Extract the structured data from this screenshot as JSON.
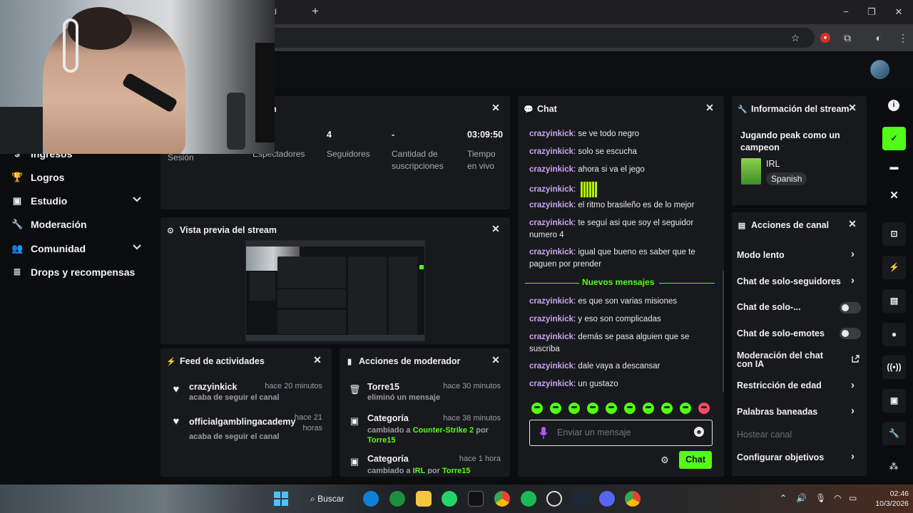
{
  "browser": {
    "tab_fragment": "ard",
    "new_tab": "+",
    "minimize": "−",
    "maximize": "❐",
    "close": "✕"
  },
  "sidebar": {
    "items": [
      {
        "label": "Ingresos",
        "icon": "dollar-icon"
      },
      {
        "label": "Logros",
        "icon": "trophy-icon"
      },
      {
        "label": "Estudio",
        "icon": "studio-icon"
      },
      {
        "label": "Moderación",
        "icon": "wrench-icon"
      },
      {
        "label": "Comunidad",
        "icon": "people-icon"
      },
      {
        "label": "Drops y recompensas",
        "icon": "drops-icon"
      }
    ]
  },
  "session": {
    "title_fragment": "n",
    "stats": [
      {
        "value": "",
        "label": "Sesión"
      },
      {
        "value": "",
        "label": "Espectadores"
      },
      {
        "value": "4",
        "label": "Seguidores"
      },
      {
        "value": "-",
        "label": "Cantidad de suscripciones"
      },
      {
        "value": "03:09:50",
        "label": "Tiempo en vivo"
      }
    ]
  },
  "preview": {
    "title": "Vista previa del stream"
  },
  "feed": {
    "title": "Feed de actividades",
    "items": [
      {
        "name": "crazyinkick",
        "sub": "acaba de seguir el canal",
        "time": "hace 20 minutos"
      },
      {
        "name": "officialgamblingacademy",
        "sub": "acaba de seguir el canal",
        "time": "hace 21 horas"
      }
    ]
  },
  "modactions": {
    "title": "Acciones de moderador",
    "items": [
      {
        "name": "Torre15",
        "sub": "eliminó un mensaje",
        "time": "hace 30 minutos"
      },
      {
        "name": "Categoría",
        "sub_prefix": "cambiado a",
        "sub_value": "Counter-Strike 2",
        "sub_by": "por",
        "sub_user": "Torre15",
        "time": "hace 38 minutos"
      },
      {
        "name": "Categoría",
        "sub_prefix": "cambiado a",
        "sub_value": "IRL",
        "sub_by": "por",
        "sub_user": "Torre15",
        "time": "hace 1 hora"
      }
    ]
  },
  "chat": {
    "title": "Chat",
    "username": "crazyinkick",
    "messages": [
      {
        "user": "crazyinkick",
        "text": ": se ve todo negro"
      },
      {
        "user": "crazyinkick",
        "text": ": solo se escucha"
      },
      {
        "user": "crazyinkick",
        "text": ": ahora si va el jego"
      },
      {
        "user": "crazyinkick",
        "text": ":"
      },
      {
        "user": "crazyinkick",
        "text": ": el ritmo brasileño es de lo mejor"
      },
      {
        "user": "crazyinkick",
        "text": ": te seguí asi que soy el seguidor numero 4"
      },
      {
        "user": "crazyinkick",
        "text": ": igual que bueno es saber que te paguen por prender"
      },
      {
        "user": "crazyinkick",
        "text": ": es que son varias misiones"
      },
      {
        "user": "crazyinkick",
        "text": ": y eso son complicadas"
      },
      {
        "user": "crazyinkick",
        "text": ": demás se pasa alguien que se suscriba"
      },
      {
        "user": "crazyinkick",
        "text": ": dale vaya a descansar"
      },
      {
        "user": "crazyinkick",
        "text": ": un gustazo"
      }
    ],
    "new_messages": "Nuevos mensajes",
    "input_placeholder": "Enviar un mensaje",
    "send_label": "Chat"
  },
  "stream_info": {
    "title": "Información del stream",
    "stream_title": "Jugando peak como un campeon",
    "category": "IRL",
    "language": "Spanish"
  },
  "channel_actions": {
    "title": "Acciones de canal",
    "rows": [
      {
        "label": "Modo lento",
        "control": "chevron"
      },
      {
        "label": "Chat de solo-seguidores",
        "control": "chevron"
      },
      {
        "label": "Chat de solo-...",
        "control": "toggle"
      },
      {
        "label": "Chat de solo-emotes",
        "control": "toggle"
      },
      {
        "label": "Moderación del chat con IA",
        "control": "external"
      },
      {
        "label": "Restricción de edad",
        "control": "chevron"
      },
      {
        "label": "Palabras baneadas",
        "control": "chevron"
      },
      {
        "label": "Hostear canal",
        "control": "none",
        "disabled": true
      },
      {
        "label": "Configurar objetivos",
        "control": "chevron"
      }
    ]
  },
  "taskbar": {
    "search_label": "Buscar",
    "time": "02:46",
    "date": "10/3/2026"
  },
  "colors": {
    "accent": "#53fc18",
    "username": "#c9a4f2",
    "panel": "#18191c",
    "background": "#0b0c0e"
  }
}
